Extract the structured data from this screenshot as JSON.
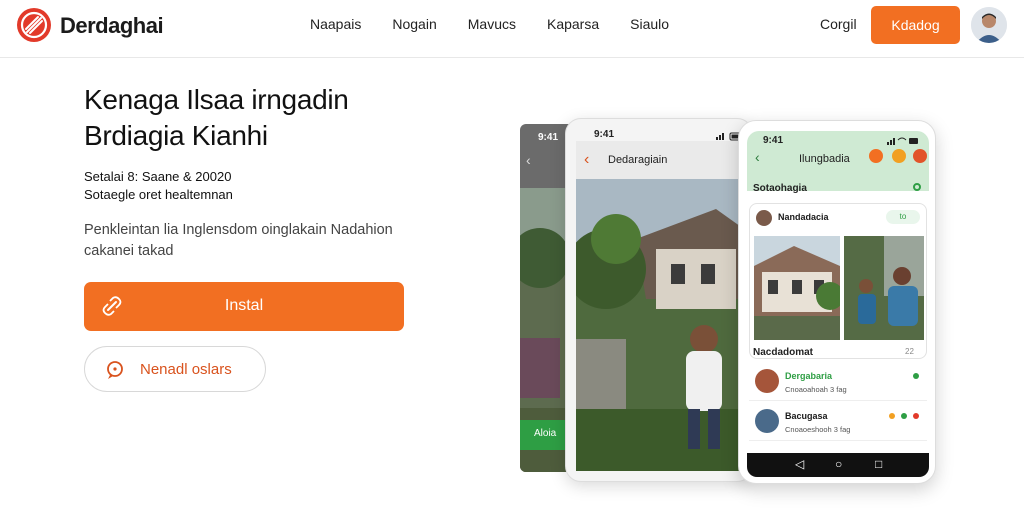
{
  "header": {
    "brand": "Derdaghai",
    "nav": [
      "Naapais",
      "Nogain",
      "Mavucs",
      "Kaparsa",
      "Siaulo"
    ],
    "signin": "Corgil",
    "cta": "Kdadog"
  },
  "hero": {
    "title_line1": "Kenaga Ilsaa irngadin",
    "title_line2": "Brdiagia Kianhi",
    "meta_line1": "Setalai 8: Saane & 20020",
    "meta_line2": "Sotaegle oret healtemnan",
    "desc_line1": "Penkleintan lia Inglensdom oinglakain Nadahion",
    "desc_line2": "cakanei takad",
    "primary_button": "Instal",
    "secondary_button": "Nenadl oslars"
  },
  "phones": {
    "back": {
      "time": "9:41",
      "green_label": "Aloia"
    },
    "mid": {
      "time": "9:41",
      "bar_title": "Dedaragiain"
    },
    "front": {
      "time": "9:41",
      "header_title": "Ilungbadia",
      "section1": "Sotaohagia",
      "post_author": "Nandadacia",
      "post_badge": "to",
      "section2": "Nacdadomat",
      "section2_badge": "22",
      "items": [
        {
          "name": "Dergabaria",
          "sub": "Cnoaoahoah 3 fag",
          "color": "#2e9e44"
        },
        {
          "name": "Bacugasa",
          "sub": "Cnoaoeshooh 3 fag",
          "color": "#222222"
        }
      ]
    }
  },
  "colors": {
    "accent": "#f26f22",
    "green": "#2e9e44",
    "logo_red": "#e23a2a"
  }
}
